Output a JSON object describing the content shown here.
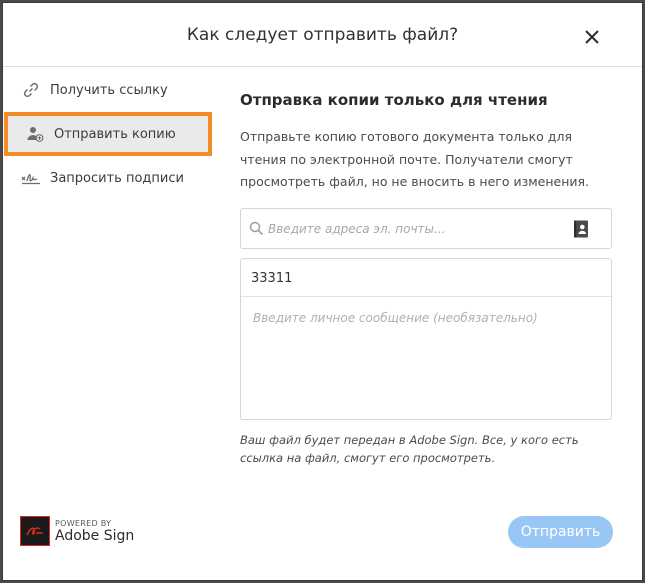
{
  "dialog": {
    "title": "Как следует отправить файл?",
    "close_icon": "close-icon"
  },
  "sidebar": {
    "items": [
      {
        "label": "Получить ссылку",
        "icon": "link-icon",
        "active": false
      },
      {
        "label": "Отправить копию",
        "icon": "add-user-icon",
        "active": true
      },
      {
        "label": "Запросить подписи",
        "icon": "signature-icon",
        "active": false
      }
    ],
    "highlight_color": "#f28b28"
  },
  "content": {
    "heading": "Отправка копии только для чтения",
    "description": "Отправьте копию готового документа только для чтения по электронной почте. Получатели смогут просмотреть файл, но не вносить в него изменения.",
    "email": {
      "placeholder": "Введите адреса эл. почты...",
      "search_icon": "search-icon",
      "addressbook_icon": "address-book-icon"
    },
    "subject_value": "33311",
    "message_placeholder": "Введите личное сообщение (необязательно)",
    "note": "Ваш файл будет передан в Adobe Sign. Все, у кого есть ссылка на файл, смогут его просмотреть."
  },
  "footer": {
    "powered_by": "POWERED BY",
    "product": "Adobe Sign",
    "logo_icon": "adobe-sign-logo-icon",
    "send_label": "Отправить",
    "send_color": "#99c7f5"
  }
}
